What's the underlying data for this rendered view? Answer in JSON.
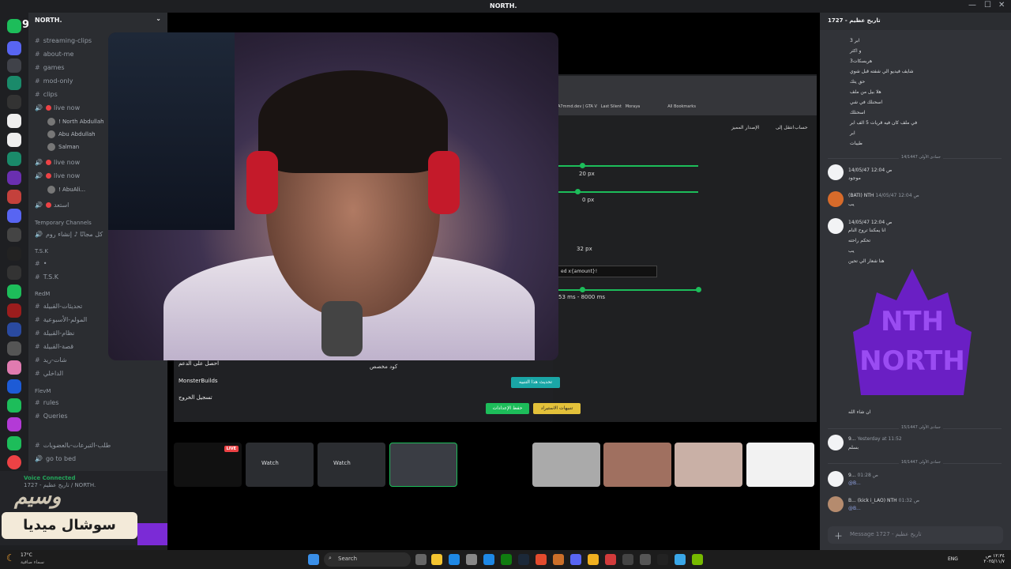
{
  "titlebar": {
    "title": "NORTH.",
    "minimize": "—",
    "maximize": "☐",
    "close": "✕"
  },
  "guild": {
    "name": "NORTH.",
    "chevron": "⌄"
  },
  "server_badge": "9",
  "channels": {
    "items": [
      {
        "label": "streaming-clips"
      },
      {
        "label": "about-me"
      },
      {
        "label": "games"
      },
      {
        "label": "mod-only"
      },
      {
        "label": "clips"
      },
      {
        "label": "live now"
      }
    ],
    "voice_users_1": [
      "! North Abdullah",
      "Abu Abdullah",
      "Salman"
    ],
    "live2": "live now",
    "live3": "live now",
    "voice_user_2": "! AbuAli...",
    "channel_ar": "استعد",
    "cat_temporary": "Temporary Channels",
    "temp_item": "كل مجانًا ♪ إنشاء روم",
    "cat_tsk": "T.S.K",
    "tsk_items": [
      "•",
      "T.S.K"
    ],
    "cat_redm": "RedM",
    "redm_items": [
      "تحديثات-القبيلة",
      "المولم-الأسبوعية",
      "نظام-القبيلة",
      "قصة-القبيلة",
      "شات-ريد",
      "الداخلي"
    ],
    "cat_flevm": "FlevM",
    "flevm_items": [
      "rules",
      "Queries"
    ],
    "misc_items": [
      "طلب-التبرعات-بالعضويات",
      "go to bed"
    ]
  },
  "voice_panel": {
    "title": "Voice Connected",
    "subtitle": "1727 - تاريخ عظيم / NORTH."
  },
  "watermark": {
    "top": "وسيم",
    "bottom": "سوشال ميديا"
  },
  "screenshare": {
    "bookmarks": [
      "A7mmd.dev | GTA V",
      "Last Silent",
      "Moraya",
      "All Bookmarks"
    ],
    "nav_labels": [
      "الإصدار المميز",
      "انتقل إلى",
      "حساب"
    ],
    "px20": "20 px",
    "px0": "0 px",
    "px32": "32 px",
    "input_value": "ed x{amount}!",
    "ms_range": "53 ms   -   8000 ms",
    "custom_code": "كود مخصص",
    "menu": [
      "احصل على الدعم",
      "MonsterBuilds",
      "تسجيل الخروج"
    ],
    "btn_update": "تحديث هذا التنبيه",
    "btn_save": "حفظ الإعدادات",
    "btn_import": "تنبيهات الاستيراد"
  },
  "tiles": {
    "watch1": "Watch",
    "watch2": "Watch",
    "live": "LIVE"
  },
  "chat": {
    "header": "1727 - تاريخ عظيم",
    "top_lines": [
      "3 ابر",
      "و اكثر",
      "3هربسكات",
      "شايف فيديو الي شفته قبل شوي",
      "حق يتك",
      "هلا بيل من ملف",
      "اسحنلك في شي",
      "اسحنلك",
      "في ملف كان فيه قريات 5 الف ابر",
      "ابر",
      "طيبات"
    ],
    "divider1": "جمادى الأولى 14/1447",
    "msg1_time": "14/05/47 12:04 ص",
    "msg1_text": "موجود",
    "msg2_name": "(BATI) NTH",
    "msg2_time": "14/05/47 12:04 ص",
    "msg2_text": "يب",
    "msg3_time": "14/05/47 12:04 ص",
    "msg3_lines": [
      "انا يمكننا تروح النام",
      "تحكم راحته",
      "يب",
      "هنا شعار الي تحين"
    ],
    "logo_text_top": "NTH",
    "logo_text_bottom": "NORTH",
    "msg3_after": "ان شاء الله",
    "divider2": "جمادى الأولى 15/1447",
    "msg4_name": "9...",
    "msg4_time": "Yesterday at 11:52",
    "msg4_text": "بسلم",
    "divider3": "جمادى الأولى 16/1447",
    "msg5_name": "9...",
    "msg5_time": "01:28 ص",
    "msg5_text": "@B...",
    "msg6_name": "B... (kick i_LAO) NTH",
    "msg6_time": "01:32 ص",
    "msg6_text": "@B...",
    "input_placeholder": "Message 1727 - تاريخ عظيم"
  },
  "taskbar": {
    "search": "Search",
    "weather_temp": "17°C",
    "weather_desc": "سماء صافية",
    "lang": "ENG",
    "time": "١٢:٣٤ ص",
    "date": "٢٠٢٥/١١/٧"
  },
  "colors": {
    "accent_green": "#1dbd5a",
    "discord_red": "#ed4245",
    "brand_purple": "#7b2bd6"
  }
}
